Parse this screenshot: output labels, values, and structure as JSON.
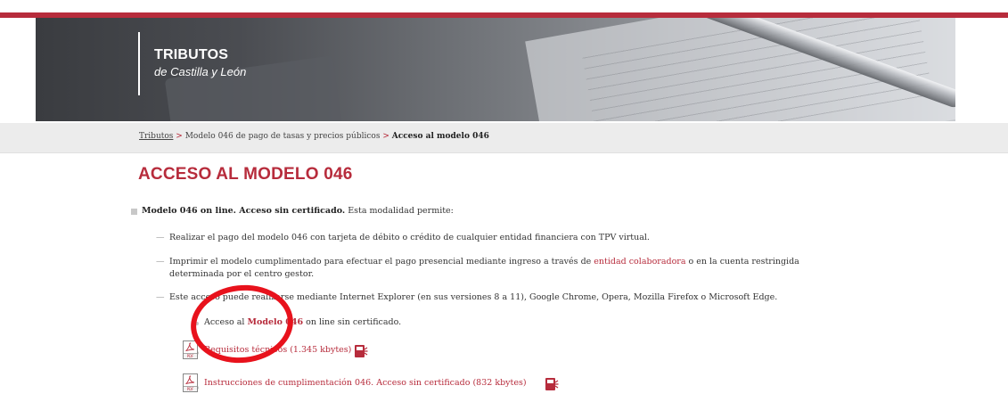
{
  "banner": {
    "brand_line1": "TRIBUTOS",
    "brand_line2": "de Castilla y León"
  },
  "breadcrumb": {
    "items": [
      "Tributos",
      "Modelo 046 de pago de tasas y precios públicos",
      "Acceso al modelo 046"
    ],
    "separator": ">"
  },
  "page_title": "ACCESO AL MODELO 046",
  "main": {
    "intro_bold": "Modelo 046 on line. Acceso sin certificado.",
    "intro_rest": " Esta modalidad permite:",
    "dash_items": [
      {
        "text": "Realizar el pago del modelo 046 con tarjeta de débito o crédito de cualquier entidad financiera con TPV virtual."
      },
      {
        "text_before": "Imprimir el modelo cumplimentado para efectuar el pago presencial mediante ingreso a través de ",
        "link": "entidad colaboradora",
        "text_after": " o en la cuenta restringida",
        "line2": "determinada por el centro gestor."
      },
      {
        "text": "Este acceso puede realizarse mediante Internet Explorer (en sus versiones 8 a 11), Google Chrome, Opera, Mozilla Firefox o Microsoft Edge."
      }
    ],
    "sub_items": [
      {
        "before": "Acceso al ",
        "link": "Modelo 046",
        "after": " on line sin certificado."
      },
      {
        "link": "Requisitos técnicos (1.345 kbytes)",
        "icon": "pdf-icon"
      },
      {
        "link": "Instrucciones de cumplimentación 046. Acceso sin certificado (832 kbytes)",
        "icon": "pdf-icon"
      }
    ],
    "pdf_icon_label": "PDF"
  },
  "colors": {
    "accent": "#b72c3c",
    "annotation": "#e8121c",
    "crumb_bg": "#ececec"
  }
}
